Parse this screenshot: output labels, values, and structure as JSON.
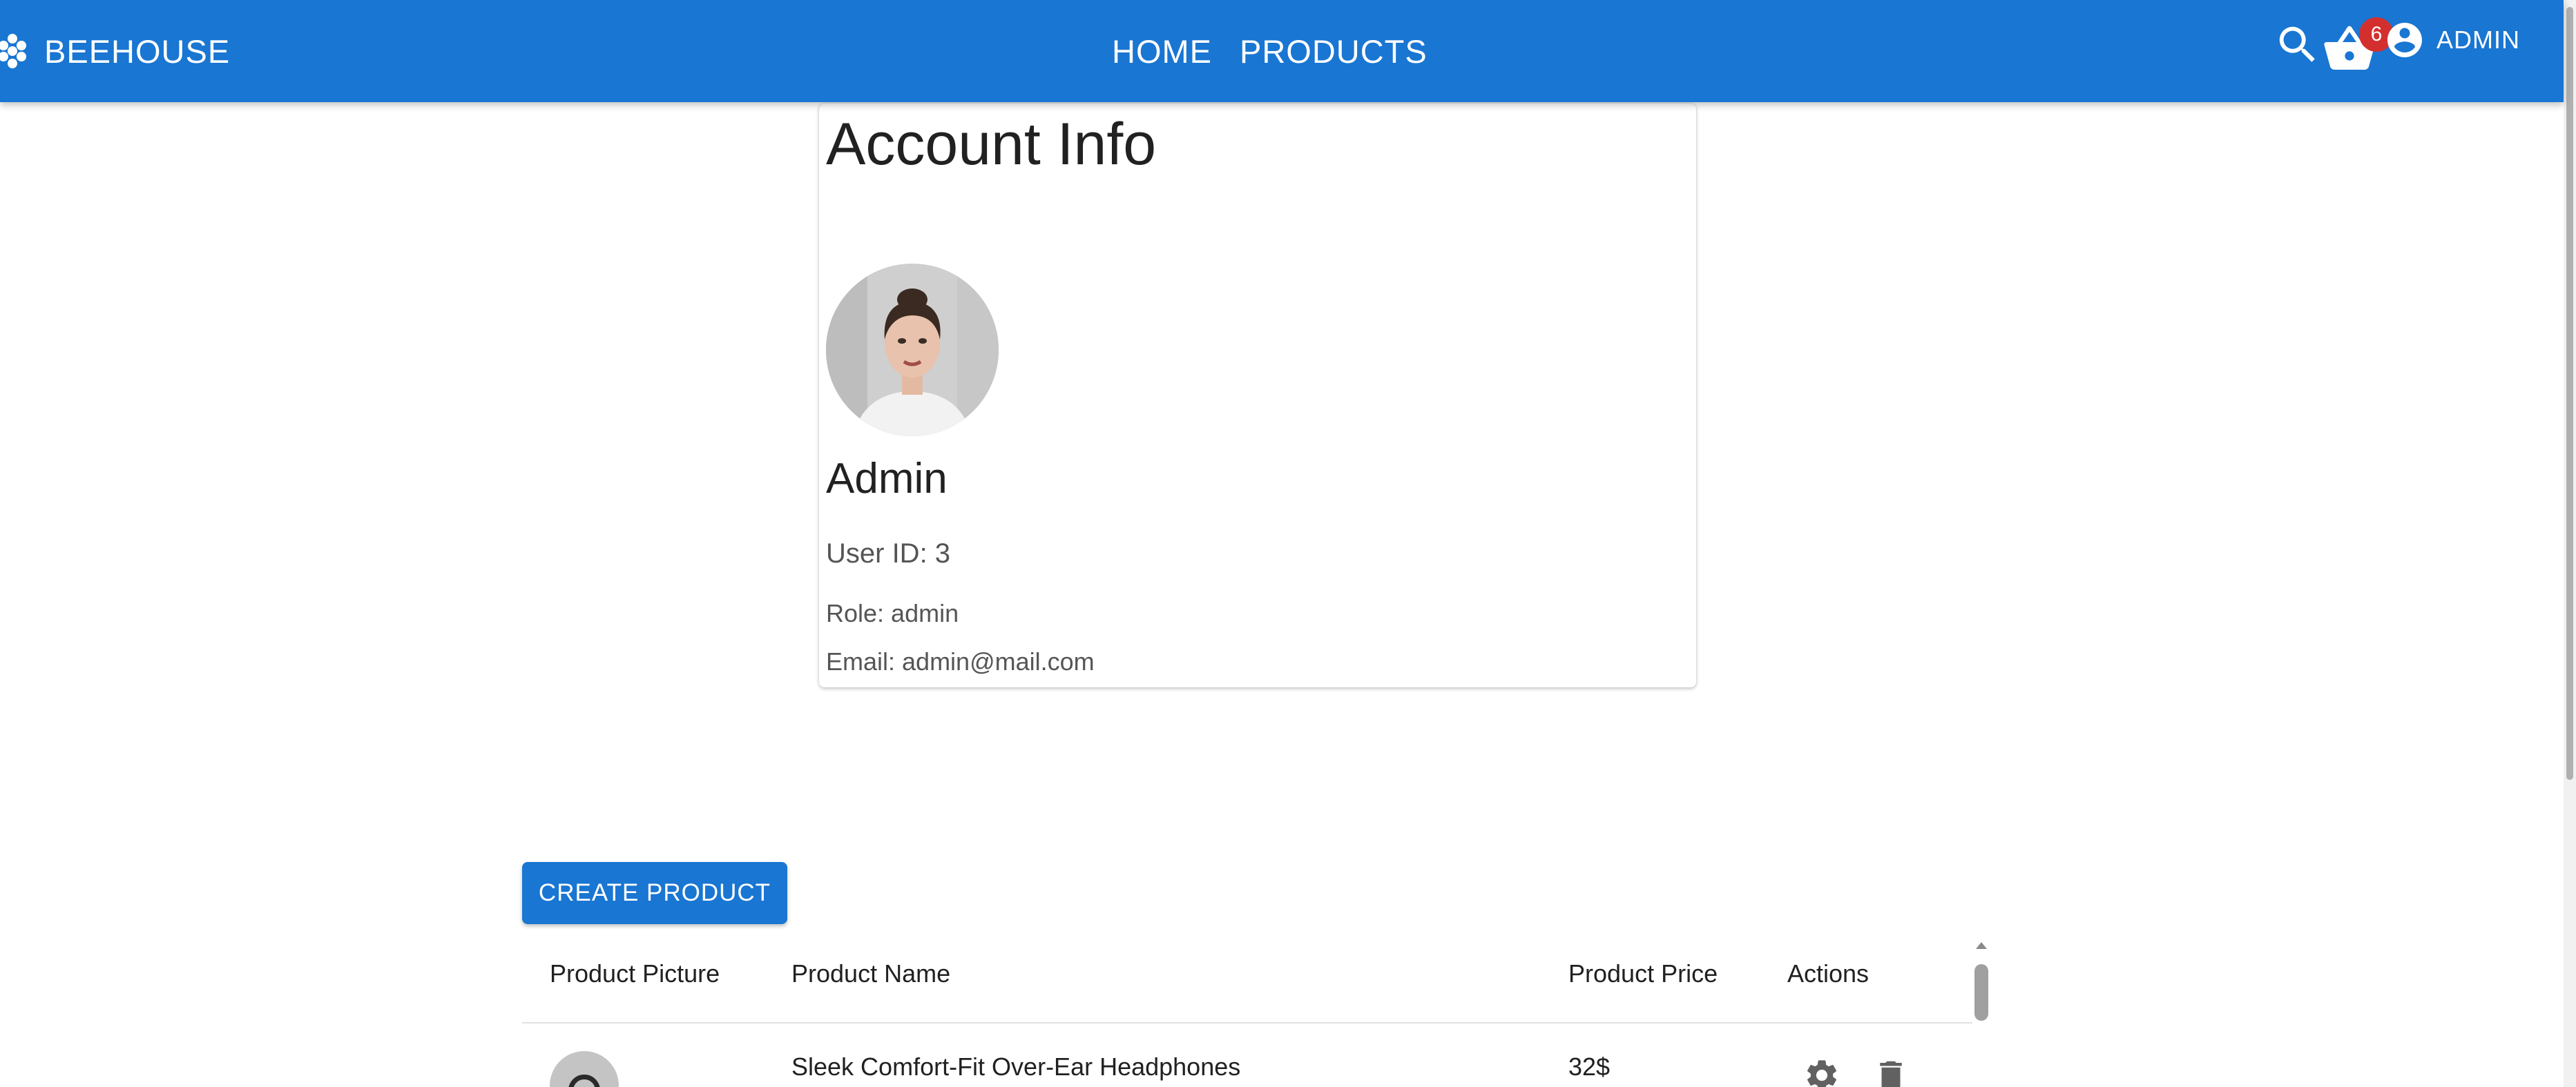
{
  "header": {
    "brand": "BEEHOUSE",
    "nav": [
      {
        "label": "HOME"
      },
      {
        "label": "PRODUCTS"
      }
    ],
    "cart_count": "6",
    "account_label": "ADMIN",
    "color": "#1976d2"
  },
  "account": {
    "title": "Account Info",
    "name": "Admin",
    "user_id": "User ID: 3",
    "role": "Role: admin",
    "email": "Email: admin@mail.com"
  },
  "products": {
    "create_label": "CREATE PRODUCT",
    "columns": [
      "Product Picture",
      "Product Name",
      "Product Price",
      "Actions"
    ],
    "rows": [
      {
        "name": "Sleek Comfort-Fit Over-Ear Headphones",
        "price": "32$"
      }
    ]
  },
  "icons": {
    "brand": "hexagon-logo-icon",
    "search": "search-icon",
    "cart": "basket-icon",
    "account": "account-circle-icon",
    "edit": "gear-icon",
    "delete": "trash-icon"
  }
}
